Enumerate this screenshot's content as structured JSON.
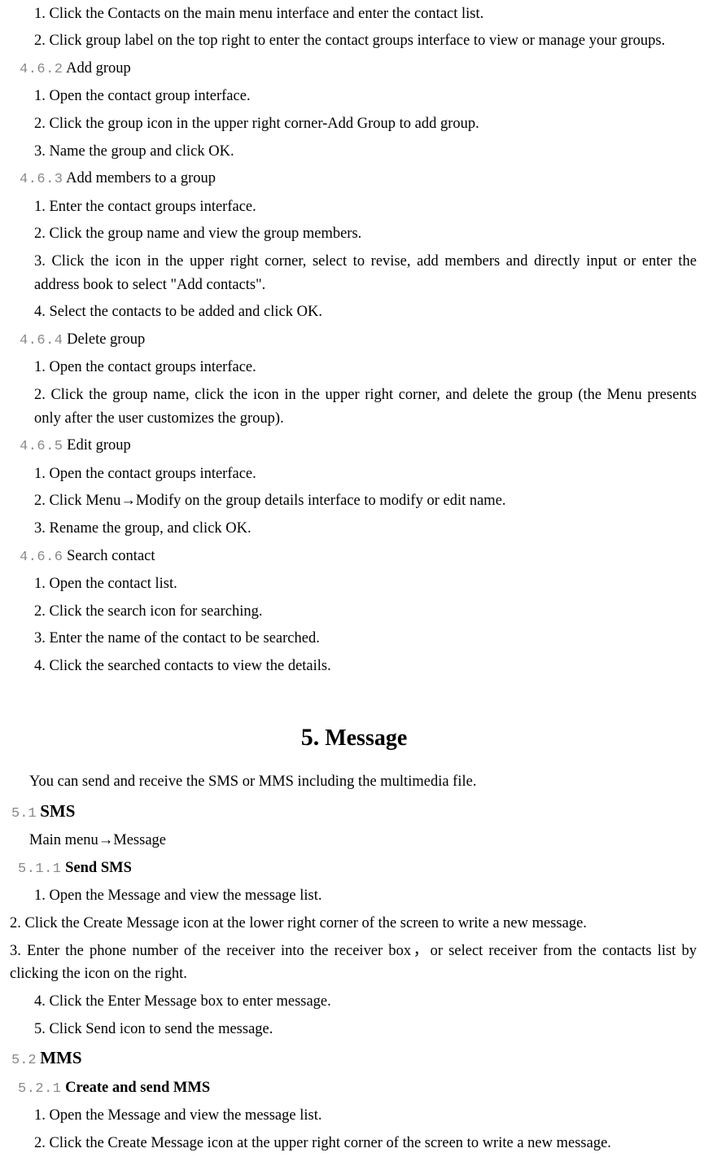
{
  "sections": {
    "s461": {
      "items": [
        "1. Click the Contacts on the main menu interface and enter the contact list.",
        "2. Click group label on the top right to enter the contact groups interface to view or manage your groups."
      ]
    },
    "s462": {
      "num": "4.6.2",
      "title": "Add group",
      "items": [
        "1. Open the contact group interface.",
        "2. Click the group icon in the upper right corner-Add Group to add group.",
        "3. Name the group and click OK."
      ]
    },
    "s463": {
      "num": "4.6.3",
      "title": "Add members to a group",
      "items": [
        "1. Enter the contact groups interface.",
        "2. Click the group name and view the group members.",
        "3. Click the icon in the upper right corner, select to revise, add members and directly input or enter the address book to select \"Add contacts\".",
        "4. Select the contacts to be added and click OK."
      ]
    },
    "s464": {
      "num": "4.6.4",
      "title": "Delete group",
      "items": [
        "1. Open the contact groups interface.",
        "2. Click the group name, click the icon in the upper right corner, and delete the group (the Menu presents only after the user customizes the group)."
      ]
    },
    "s465": {
      "num": "4.6.5",
      "title": "Edit group",
      "items": [
        "1. Open the contact groups interface.",
        "2. Click Menu→Modify on the group details interface to modify or edit name.",
        "3. Rename the group, and click OK."
      ]
    },
    "s466": {
      "num": "4.6.6",
      "title": "Search contact",
      "items": [
        "1. Open the contact list.",
        "2. Click the search icon for searching.",
        "3. Enter the name of the contact to be searched.",
        "4. Click the searched contacts to view the details."
      ]
    }
  },
  "chapter5": {
    "title": "5. Message",
    "intro": "You can send and receive the SMS or MMS including the multimedia file.",
    "s51": {
      "num": "5.1",
      "title": "SMS",
      "nav": "Main menu→Message",
      "s511": {
        "num": "5.1.1",
        "title": "Send SMS",
        "items": [
          "1. Open the Message and view the message list.",
          "2. Click the Create Message icon at the lower right corner of the screen to write a new message.",
          "3. Enter the phone number of the receiver into the receiver box，or select receiver from the contacts list by clicking the icon on the right.",
          "4. Click the Enter Message box to enter message.",
          "5. Click Send icon to send the message."
        ]
      }
    },
    "s52": {
      "num": "5.2",
      "title": "MMS",
      "s521": {
        "num": "5.2.1",
        "title": "Create and send MMS",
        "items": [
          "1. Open the Message and view the message list.",
          "2. Click the Create Message icon at the upper right corner of the screen to write a new message."
        ]
      }
    }
  }
}
